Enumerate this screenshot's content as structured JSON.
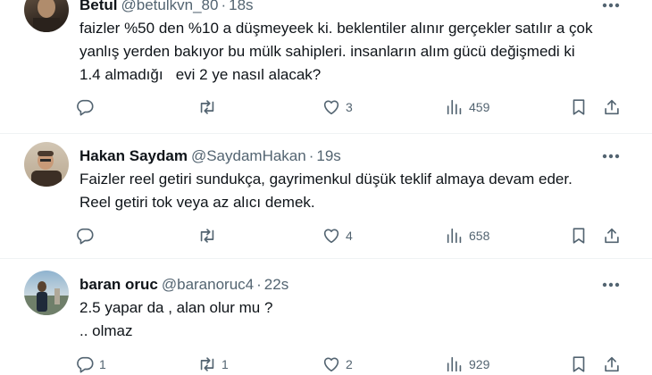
{
  "tweets": [
    {
      "name": "Betul",
      "handle": "@betulkvn_80",
      "time": "18s",
      "lines": [
        "faizler %50 den %10 a düşmeyeek ki. beklentiler alınır gerçekler satılır a çok",
        "yanlış yerden bakıyor bu mülk sahipleri. insanların alım gücü değişmedi ki",
        "1.4 almadığı   evi 2 ye nasıl alacak?"
      ],
      "replies": "",
      "retweets": "",
      "likes": "3",
      "views": "459"
    },
    {
      "name": "Hakan Saydam",
      "handle": "@SaydamHakan",
      "time": "19s",
      "lines": [
        "Faizler reel getiri sundukça, gayrimenkul düşük teklif almaya devam eder.",
        "Reel getiri tok veya az alıcı demek."
      ],
      "replies": "",
      "retweets": "",
      "likes": "4",
      "views": "658"
    },
    {
      "name": "baran oruc",
      "handle": "@baranoruc4",
      "time": "22s",
      "lines": [
        "2.5 yapar da , alan olur mu ?",
        ".. olmaz"
      ],
      "replies": "1",
      "retweets": "1",
      "likes": "2",
      "views": "929"
    }
  ],
  "icons": {
    "more": "more-icon",
    "reply": "reply-icon",
    "retweet": "retweet-icon",
    "like": "heart-icon",
    "views": "views-icon",
    "bookmark": "bookmark-icon",
    "share": "share-icon"
  },
  "colors": {
    "text": "#0f1419",
    "muted": "#536471",
    "divider": "#eff3f4"
  }
}
